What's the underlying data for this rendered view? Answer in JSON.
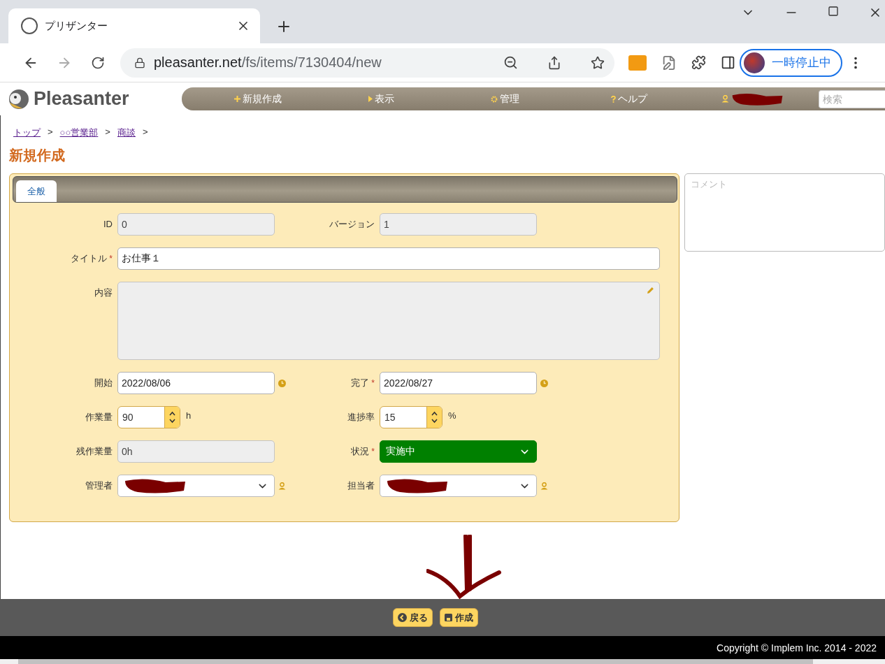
{
  "browser": {
    "tab_title": "プリザンター",
    "url_host": "pleasanter.net",
    "url_path": "/fs/items/7130404/new",
    "profile_status": "一時停止中"
  },
  "header": {
    "logo": "Pleasanter",
    "nav": [
      {
        "kind": "link",
        "label": "新規作成"
      },
      {
        "kind": "link",
        "label": "表示"
      },
      {
        "kind": "link",
        "label": "管理"
      },
      {
        "kind": "link",
        "label": "ヘルプ"
      },
      {
        "kind": "user"
      }
    ],
    "search": {
      "placeholder": "検索"
    }
  },
  "breadcrumb": {
    "separator": ">",
    "items": [
      "トップ",
      "○○営業部",
      "商談"
    ]
  },
  "page_title": "新規作成",
  "tabs": [
    {
      "label": "全般",
      "selected": true
    }
  ],
  "form_rows": [
    [
      {
        "kind": "text",
        "label": "ID",
        "value": "0",
        "readonly": true
      },
      {
        "kind": "text",
        "label": "バージョン",
        "value": "1",
        "readonly": true
      }
    ],
    [
      {
        "kind": "wide-text",
        "label": "タイトル",
        "required_mark": "*",
        "value": "お仕事１",
        "readonly": false
      }
    ],
    [
      {
        "kind": "textarea",
        "label": "内容",
        "readonly": true
      }
    ],
    [
      {
        "kind": "date",
        "label": "開始",
        "value": "2022/08/06",
        "readonly": false
      },
      {
        "kind": "date",
        "label": "完了",
        "required_mark": "*",
        "value": "2022/08/27",
        "readonly": false
      }
    ],
    [
      {
        "kind": "spinner",
        "label": "作業量",
        "value": "90",
        "unit": "h"
      },
      {
        "kind": "spinner",
        "label": "進捗率",
        "value": "15",
        "unit": "%"
      }
    ],
    [
      {
        "kind": "text",
        "label": "残作業量",
        "value": "0h",
        "readonly": true
      },
      {
        "kind": "select",
        "label": "状況",
        "required_mark": "*",
        "value": "実施中",
        "color": "#008000"
      }
    ],
    [
      {
        "kind": "user-select",
        "label": "管理者"
      },
      {
        "kind": "user-select",
        "label": "担当者"
      }
    ]
  ],
  "comment": {
    "placeholder": "コメント"
  },
  "buttons": [
    {
      "label": "戻る"
    },
    {
      "label": "作成"
    }
  ],
  "copyright": "Copyright © Implem Inc. 2014 - 2022"
}
